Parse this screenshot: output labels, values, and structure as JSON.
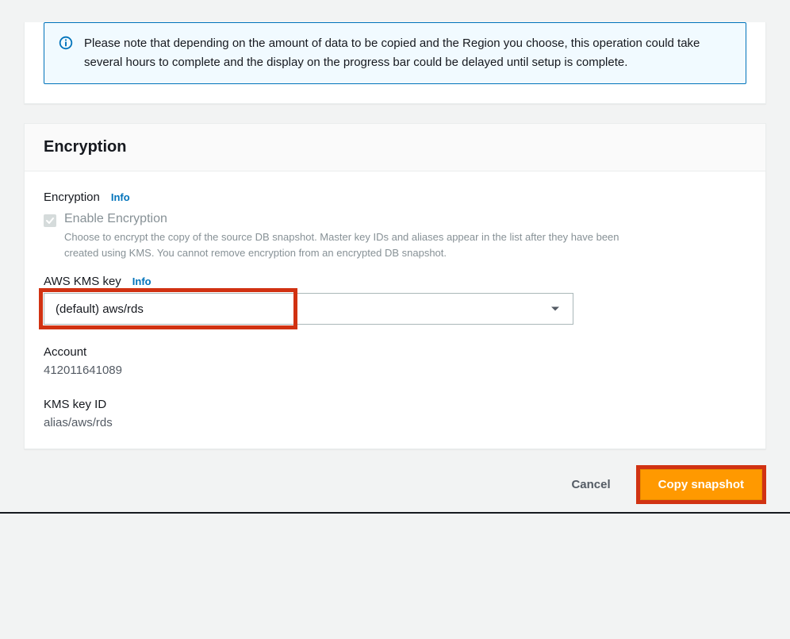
{
  "alert": {
    "text": "Please note that depending on the amount of data to be copied and the Region you choose, this operation could take several hours to complete and the display on the progress bar could be delayed until setup is complete."
  },
  "encryption": {
    "section_title": "Encryption",
    "field_label": "Encryption",
    "info_label": "Info",
    "checkbox_title": "Enable Encryption",
    "checkbox_desc": "Choose to encrypt the copy of the source DB snapshot. Master key IDs and aliases appear in the list after they have been created using KMS. You cannot remove encryption from an encrypted DB snapshot.",
    "kms_label": "AWS KMS key",
    "kms_info_label": "Info",
    "kms_selected": "(default) aws/rds",
    "account_label": "Account",
    "account_value": "412011641089",
    "kms_key_id_label": "KMS key ID",
    "kms_key_id_value": "alias/aws/rds"
  },
  "footer": {
    "cancel_label": "Cancel",
    "primary_label": "Copy snapshot"
  }
}
